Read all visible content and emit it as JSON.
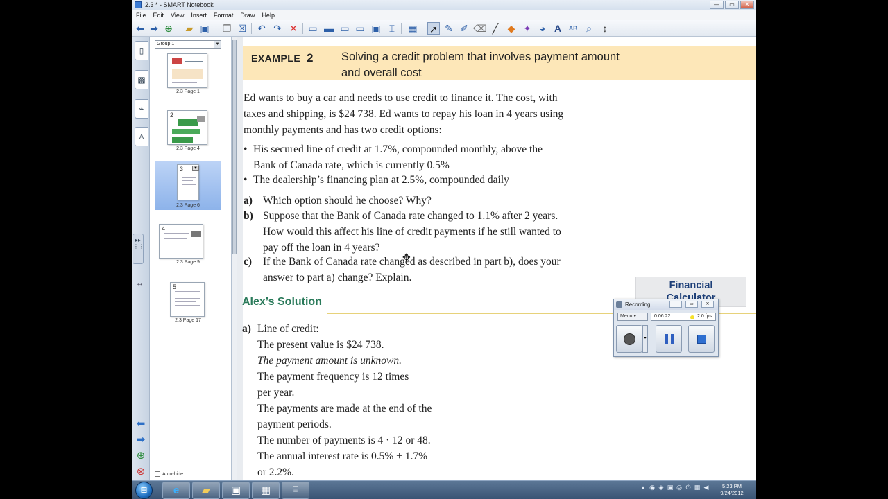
{
  "window": {
    "title": "2.3 * - SMART Notebook",
    "buttons": {
      "minimize": "—",
      "maximize": "▭",
      "close": "✕"
    }
  },
  "menu": [
    "File",
    "Edit",
    "View",
    "Insert",
    "Format",
    "Draw",
    "Help"
  ],
  "toolbar": {
    "icons": [
      "back-arrow-icon",
      "forward-arrow-icon",
      "add-page-icon",
      "open-folder-icon",
      "save-icon",
      "paste-icon",
      "delete-page-icon",
      "undo-icon",
      "redo-icon",
      "delete-icon",
      "screen-shade-icon",
      "full-screen-icon",
      "dual-page-icon",
      "display-icon",
      "capture-icon",
      "document-camera-icon",
      "table-icon",
      "select-icon",
      "pen-icon",
      "creative-pen-icon",
      "eraser-icon",
      "line-icon",
      "shape-icon",
      "magic-pen-icon",
      "fill-icon",
      "text-icon",
      "properties-icon",
      "zoom-icon",
      "more-icon"
    ]
  },
  "sorter": {
    "group": "Group 1",
    "thumbnails": [
      {
        "num": "",
        "label": "2.3 Page 1"
      },
      {
        "num": "2",
        "label": "2.3 Page 4"
      },
      {
        "num": "3",
        "label": "2.3 Page 6"
      },
      {
        "num": "4",
        "label": "2.3 Page 9"
      },
      {
        "num": "5",
        "label": "2.3 Page 17"
      }
    ],
    "autohide": "Auto-hide"
  },
  "example": {
    "label": "EXAMPLE",
    "number": "2",
    "heading_line1": "Solving a credit problem that involves payment amount",
    "heading_line2": "and overall cost"
  },
  "intro": [
    "Ed wants to buy a car and needs to use credit to finance it. The cost, with",
    "taxes and shipping, is $24 738. Ed wants to repay his loan in 4 years using",
    "monthly payments and has two credit options:"
  ],
  "bullets": [
    {
      "line1": "His secured line of credit at 1.7%, compounded monthly, above the",
      "line2": "Bank of Canada rate, which is currently 0.5%"
    },
    {
      "line1": "The dealership’s financing plan at 2.5%, compounded daily",
      "line2": ""
    }
  ],
  "questions": [
    {
      "label": "a)",
      "lines": [
        "Which option should he choose? Why?"
      ]
    },
    {
      "label": "b)",
      "lines": [
        "Suppose that the Bank of Canada rate changed to 1.1% after 2 years.",
        "How would this affect his line of credit payments if he still wanted to",
        "pay off the loan in 4 years?"
      ]
    },
    {
      "label": "c)",
      "lines": [
        "If the Bank of Canada rate changed as described in part b), does your",
        "answer to part a) change? Explain."
      ]
    }
  ],
  "solution": {
    "title": "Alex’s Solution",
    "part_label": "a)",
    "lines": [
      "Line of credit:",
      "The present value is $24 738.",
      "The payment amount is unknown.",
      "The payment frequency is 12 times",
      "per year.",
      "The payments are made at the end of the",
      "payment periods.",
      "The number of payments is 4 · 12 or 48.",
      "The annual interest rate is 0.5% + 1.7%",
      "or 2.2%."
    ]
  },
  "financial_calculator": {
    "line1": "Financial",
    "line2": "Calculator"
  },
  "recorder": {
    "title": "Recording...",
    "menu": "Menu",
    "elapsed": "0:06:22",
    "fps": "2.0 fps"
  },
  "taskbar": {
    "clock_time": "5:23 PM",
    "clock_date": "9/24/2012"
  },
  "colors": {
    "example_band": "#fde7b8",
    "solution_title": "#2a7a5a",
    "calc_text": "#1d3f78"
  }
}
